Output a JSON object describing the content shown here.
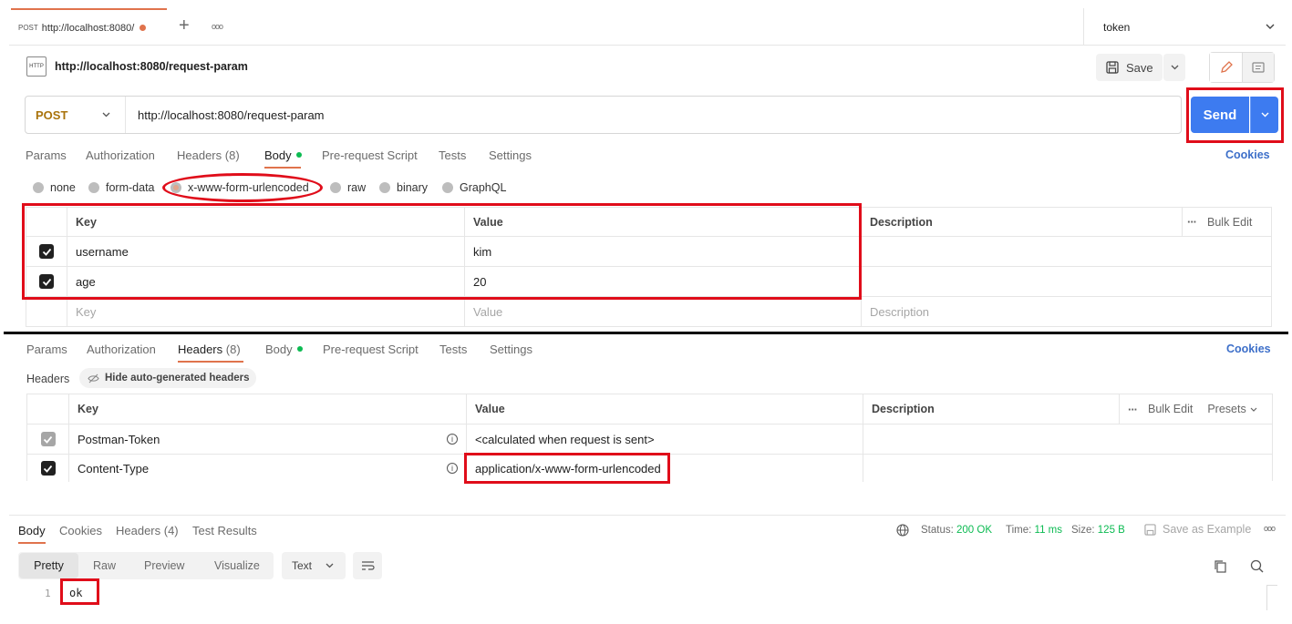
{
  "tabs": {
    "active_method": "POST",
    "active_url": "http://localhost:8080/",
    "add_symbol": "+",
    "more_symbol": "ooo"
  },
  "environment": {
    "selected": "token"
  },
  "request": {
    "icon_text": "HTTP",
    "name": "http://localhost:8080/request-param",
    "save_label": "Save",
    "method": "POST",
    "url": "http://localhost:8080/request-param",
    "send_label": "Send",
    "cookies_label": "Cookies"
  },
  "req_tabs": [
    {
      "label": "Params"
    },
    {
      "label": "Authorization"
    },
    {
      "label": "Headers",
      "count": "(8)"
    },
    {
      "label": "Body"
    },
    {
      "label": "Pre-request Script"
    },
    {
      "label": "Tests"
    },
    {
      "label": "Settings"
    }
  ],
  "body_types": [
    "none",
    "form-data",
    "x-www-form-urlencoded",
    "raw",
    "binary",
    "GraphQL"
  ],
  "body_table": {
    "headers": {
      "key": "Key",
      "value": "Value",
      "description": "Description"
    },
    "bulk_edit": "Bulk Edit",
    "rows": [
      {
        "key": "username",
        "value": "kim",
        "description": ""
      },
      {
        "key": "age",
        "value": "20",
        "description": ""
      }
    ],
    "placeholder": {
      "key": "Key",
      "value": "Value",
      "description": "Description"
    }
  },
  "headers_section": {
    "title": "Headers",
    "hide_auto": "Hide auto-generated headers",
    "table_headers": {
      "key": "Key",
      "value": "Value",
      "description": "Description"
    },
    "bulk_edit": "Bulk Edit",
    "presets": "Presets",
    "rows": [
      {
        "key": "Postman-Token",
        "value": "<calculated when request is sent>"
      },
      {
        "key": "Content-Type",
        "value": "application/x-www-form-urlencoded"
      }
    ]
  },
  "response": {
    "tabs": [
      {
        "label": "Body"
      },
      {
        "label": "Cookies"
      },
      {
        "label": "Headers (4)"
      },
      {
        "label": "Test Results"
      }
    ],
    "status_label": "Status:",
    "status_value": "200 OK",
    "time_label": "Time:",
    "time_value": "11 ms",
    "size_label": "Size:",
    "size_value": "125 B",
    "save_example": "Save as Example",
    "view_modes": [
      "Pretty",
      "Raw",
      "Preview",
      "Visualize"
    ],
    "format": "Text",
    "line_number": "1",
    "body_line": "ok"
  },
  "colors": {
    "accent_orange": "#e0734c",
    "send_blue": "#3d7bf0",
    "annotation_red": "#e00d1a",
    "status_green": "#0cbb52"
  }
}
